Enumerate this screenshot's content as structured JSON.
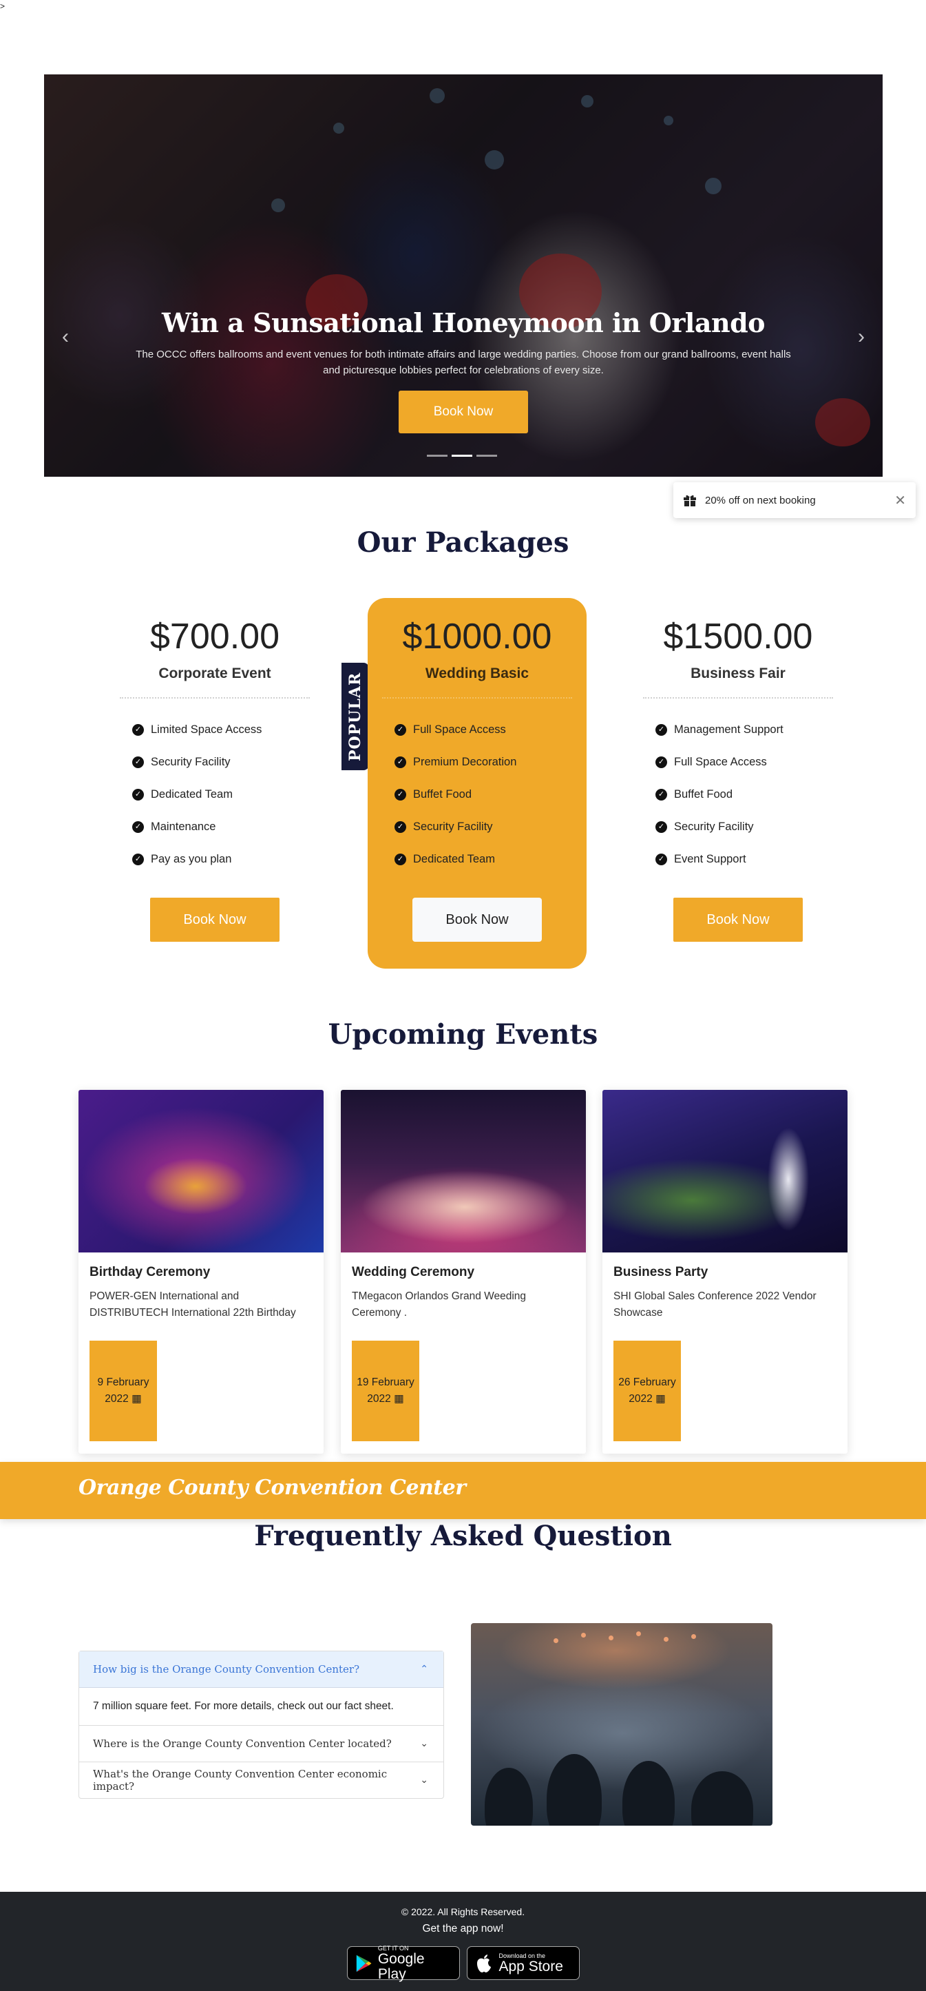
{
  "stray_text": ">",
  "hero": {
    "title": "Win a Sunsational Honeymoon in Orlando",
    "text": "The OCCC offers ballrooms and event venues for both intimate affairs and large wedding parties. Choose from our grand ballrooms, event halls and picturesque lobbies perfect for celebrations of every size.",
    "button": "Book Now",
    "prev_icon": "chevron-left-icon",
    "next_icon": "chevron-right-icon",
    "slides": 3,
    "active_slide": 2
  },
  "promo": {
    "icon": "gift-icon",
    "text": "20% off on next booking",
    "close_icon": "close-icon"
  },
  "packages": {
    "title": "Our Packages",
    "popular_label": "POPULAR",
    "items": [
      {
        "price": "$700.00",
        "name": "Corporate Event",
        "features": [
          "Limited Space Access",
          "Security Facility",
          "Dedicated Team",
          "Maintenance",
          "Pay as you plan"
        ],
        "button": "Book Now"
      },
      {
        "price": "$1000.00",
        "name": "Wedding Basic",
        "features": [
          "Full Space Access",
          "Premium Decoration",
          "Buffet Food",
          "Security Facility",
          "Dedicated Team"
        ],
        "button": "Book Now"
      },
      {
        "price": "$1500.00",
        "name": "Business Fair",
        "features": [
          "Management Support",
          "Full Space Access",
          "Buffet Food",
          "Security Facility",
          "Event Support"
        ],
        "button": "Book Now"
      }
    ]
  },
  "events": {
    "title": "Upcoming Events",
    "items": [
      {
        "title": "Birthday Ceremony",
        "desc": "POWER-GEN International and DISTRIBUTECH International 22th Birthday",
        "date_line1": "9 February",
        "date_line2": "2022"
      },
      {
        "title": "Wedding Ceremony",
        "desc": "TMegacon Orlandos Grand Weeding Ceremony .",
        "date_line1": "19 February",
        "date_line2": "2022"
      },
      {
        "title": "Business Party",
        "desc": "SHI Global Sales Conference 2022 Vendor Showcase",
        "date_line1": "26 February",
        "date_line2": "2022"
      }
    ]
  },
  "banner": {
    "text": "Orange County Convention Center"
  },
  "faq": {
    "title": "Frequently Asked Question",
    "items": [
      {
        "q": "How big is the Orange County Convention Center?",
        "a": "7 million square feet. For more details, check out our fact sheet.",
        "open": true
      },
      {
        "q": "Where is the Orange County Convention Center located?",
        "open": false
      },
      {
        "q": "What's the Orange County Convention Center economic impact?",
        "open": false
      }
    ]
  },
  "footer": {
    "copyright": "© 2022. All Rights Reserved.",
    "get_app": "Get the app now!",
    "google": {
      "small": "GET IT ON",
      "big": "Google Play"
    },
    "apple": {
      "small": "Download on the",
      "big": "App Store"
    }
  },
  "colors": {
    "accent": "#f0a929",
    "navy": "#161a3a",
    "footer": "#222529",
    "faq_open": "#e7f1fd"
  }
}
